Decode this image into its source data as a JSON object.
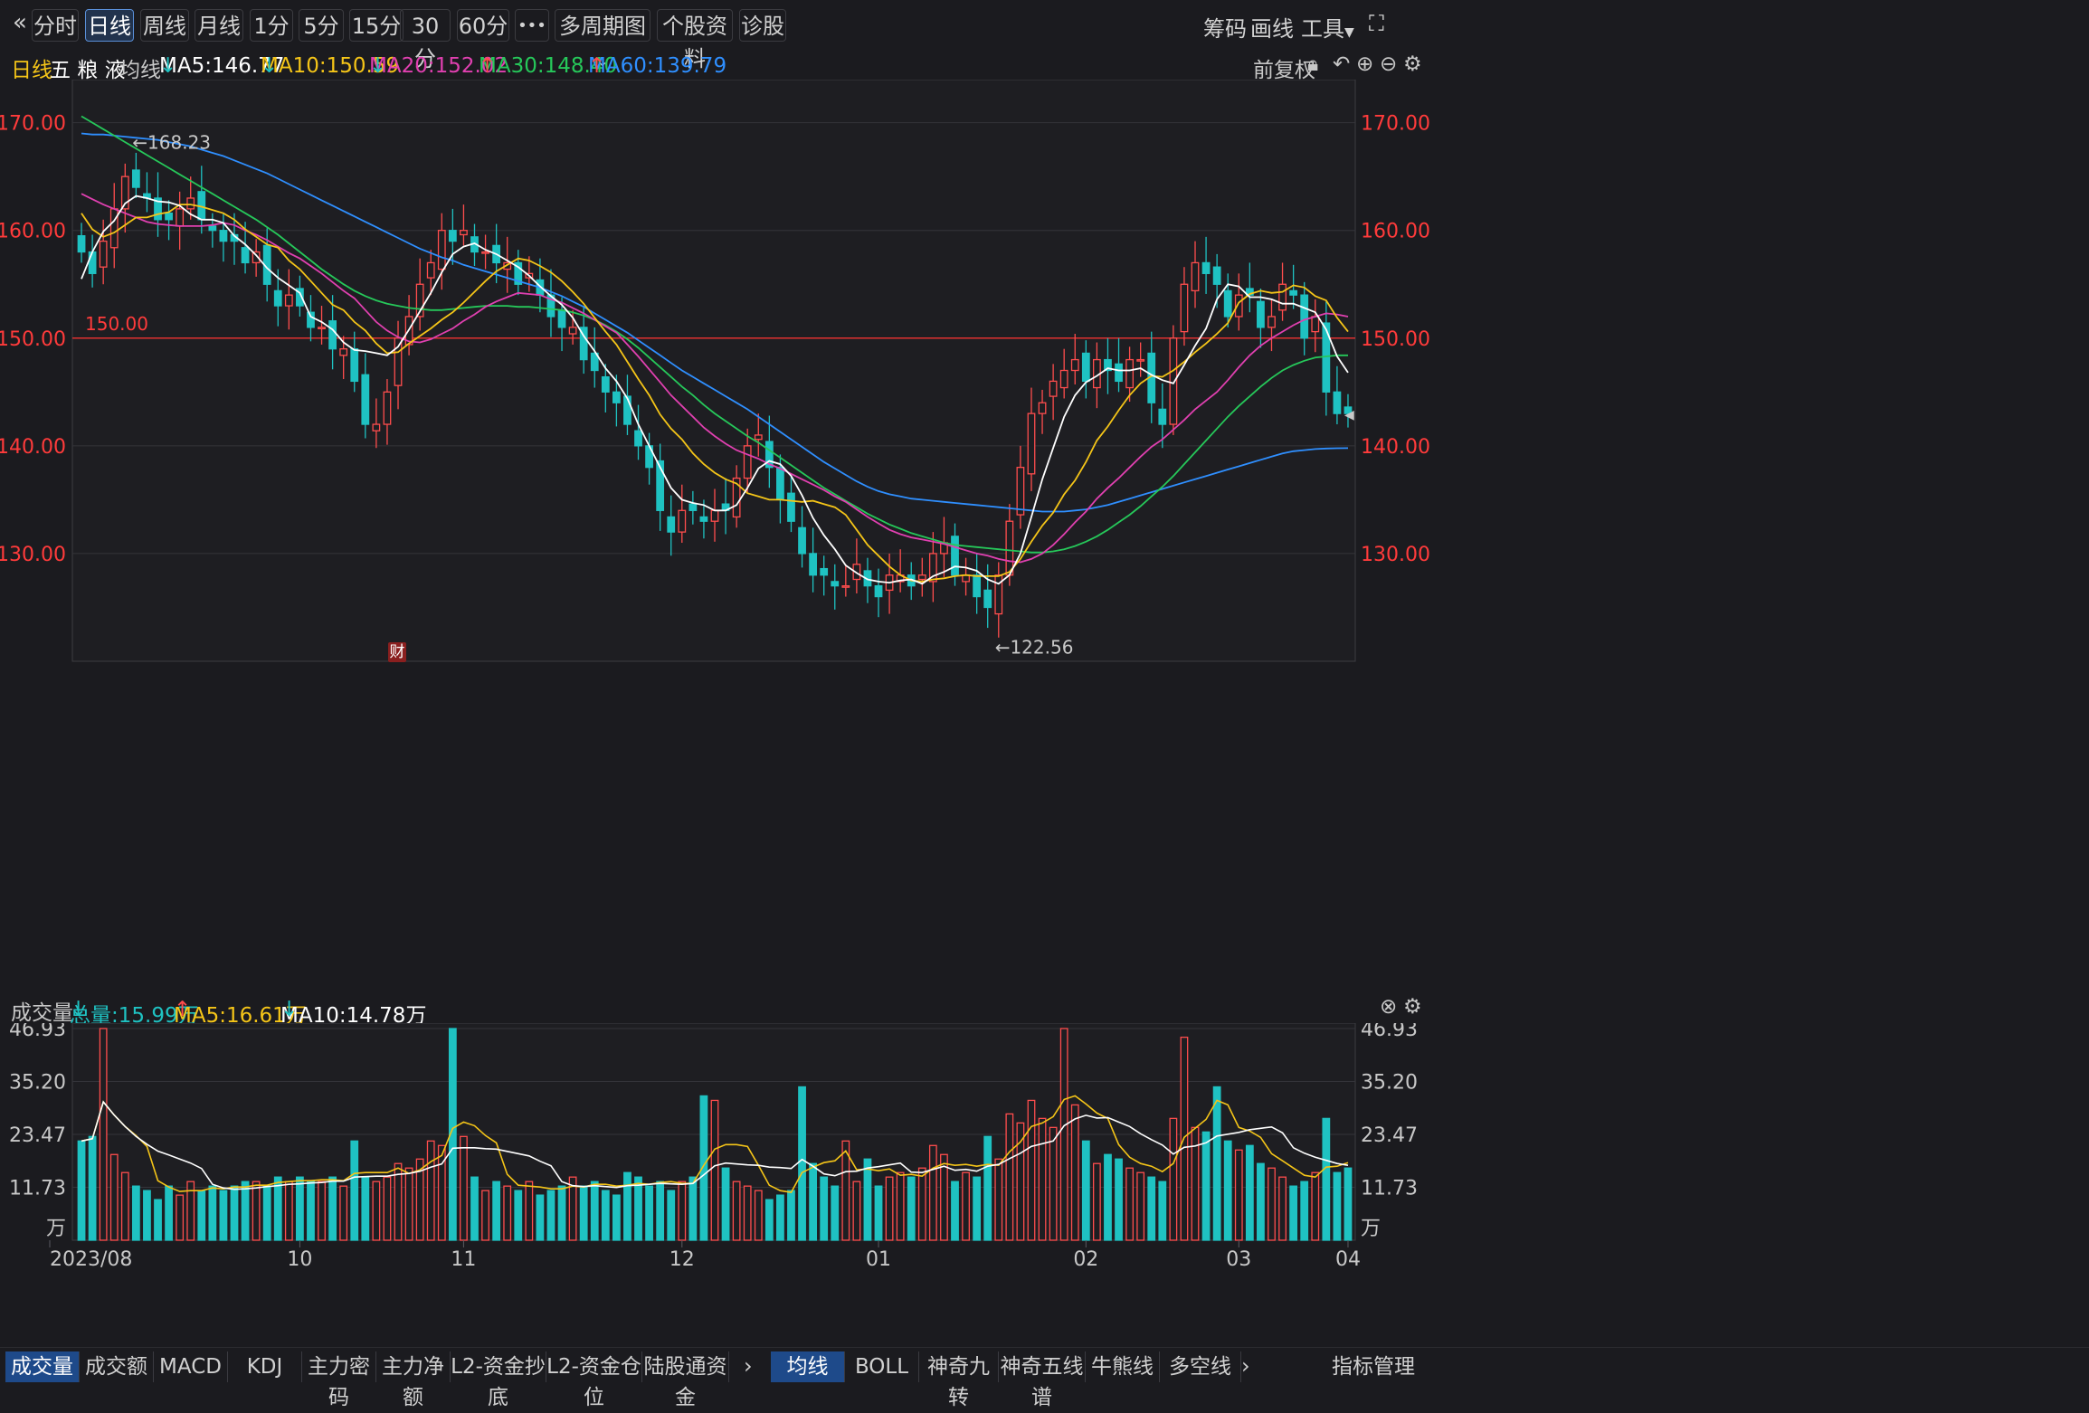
{
  "toolbar": {
    "back_glyph": "«",
    "tabs": [
      "分时",
      "日线",
      "周线",
      "月线",
      "1分",
      "5分",
      "15分",
      "30分",
      "60分"
    ],
    "active_tab": "日线",
    "more_glyph": "•••",
    "multi_period": "多周期图",
    "stock_info": "个股资料",
    "diagnose": "诊股",
    "right": [
      "筹码",
      "画线",
      "工具"
    ],
    "fullscreen_glyph": "⛶"
  },
  "info": {
    "period": "日线",
    "name": "五 粮 液",
    "ma_label": "均线",
    "ma5": "MA5:146.77",
    "ma10": "MA10:150.59",
    "ma20": "MA20:152.02",
    "ma30": "MA30:148.40",
    "ma60": "MA60:139.79",
    "adjust": "前复权"
  },
  "volume_info": {
    "title": "成交量",
    "total": "总量:15.99万",
    "ma5": "MA5:16.61万",
    "ma10": "MA10:14.78万"
  },
  "bottom_tabs_left": [
    "成交量",
    "成交额",
    "MACD",
    "KDJ",
    "主力密码",
    "主力净额",
    "L2-资金抄底",
    "L2-资金仓位",
    "陆股通资金"
  ],
  "bottom_tabs_right": [
    "均线",
    "BOLL",
    "神奇九转",
    "神奇五线谱",
    "牛熊线",
    "多空线"
  ],
  "bottom_active_left": "成交量",
  "bottom_active_right": "均线",
  "indicator_manage": "指标管理",
  "colors": {
    "up": "#ff4d4d",
    "down": "#1fc2c2",
    "ma5": "#ffffff",
    "ma10": "#f5c518",
    "ma20": "#e040b0",
    "ma30": "#26c85a",
    "ma60": "#2f8fff",
    "axis_text": "#ff3b3b"
  },
  "chart_data": {
    "type": "candlestick",
    "price_axis": {
      "ticks": [
        "170.00",
        "160.00",
        "150.00",
        "140.00",
        "130.00"
      ],
      "ylim": [
        120,
        174
      ]
    },
    "reference_line": {
      "value": 150.0,
      "label": "150.00"
    },
    "annotations": [
      {
        "text": "←168.23",
        "value": 168.23
      },
      {
        "text": "←122.56",
        "value": 122.56
      }
    ],
    "finance_marker": "财",
    "x_labels": [
      "2023/08",
      "10",
      "11",
      "12",
      "01",
      "02",
      "03",
      "04"
    ],
    "closes": [
      158,
      156,
      159,
      162,
      165,
      164,
      163,
      161,
      161,
      162,
      163,
      161,
      160,
      159,
      159,
      157,
      158,
      155,
      153,
      154,
      153,
      151,
      151,
      149,
      149,
      146,
      142,
      142,
      145,
      150,
      152,
      155,
      157,
      160,
      159,
      160,
      158,
      158,
      157,
      157,
      155,
      156,
      154,
      152,
      151,
      151,
      148,
      147,
      145,
      144,
      142,
      140,
      138,
      134,
      132,
      134,
      134,
      133,
      134,
      134,
      137,
      140,
      141,
      138,
      135,
      133,
      130,
      128,
      128,
      127,
      127,
      129,
      127,
      126,
      128,
      128,
      127,
      128,
      130,
      131,
      128,
      128,
      126,
      125,
      128,
      133,
      138,
      143,
      144,
      146,
      147,
      148,
      146,
      148,
      147,
      146,
      148,
      148,
      144,
      142,
      150,
      155,
      157,
      156,
      155,
      152,
      154,
      154,
      151,
      152,
      155,
      154,
      150,
      152,
      145,
      143,
      143
    ],
    "ma5": [
      155.5,
      158.0,
      159.9,
      160.9,
      162.5,
      163.2,
      163.0,
      162.7,
      162.6,
      162.3,
      161.5,
      161.0,
      161.0,
      160.7,
      159.5,
      158.7,
      157.7,
      156.5,
      155.6,
      154.9,
      154.2,
      152.0,
      151.5,
      150.8,
      149.6,
      148.9,
      148.8,
      148.6,
      148.4,
      149.2,
      150.8,
      152.5,
      154.2,
      156.1,
      157.8,
      158.5,
      158.8,
      158.2,
      157.8,
      157.2,
      156.6,
      155.8,
      154.8,
      153.9,
      153.1,
      151.9,
      150.2,
      148.8,
      147.2,
      146.0,
      144.4,
      142.0,
      140.0,
      138.0,
      136.1,
      135.0,
      134.7,
      134.5,
      134.0,
      134.0,
      134.5,
      136.1,
      137.9,
      138.6,
      138.3,
      137.2,
      135.4,
      133.3,
      131.7,
      130.4,
      128.9,
      128.2,
      127.6,
      127.4,
      127.3,
      127.5,
      127.6,
      127.2,
      127.9,
      128.3,
      128.8,
      128.7,
      128.4,
      127.6,
      127.2,
      128.0,
      130.0,
      133.4,
      136.9,
      139.8,
      142.7,
      144.7,
      145.9,
      146.5,
      147.2,
      147.0,
      147.0,
      147.2,
      146.6,
      146.1,
      145.8,
      147.5,
      149.3,
      150.9,
      153.6,
      155.0,
      154.8,
      153.8,
      153.8,
      153.6,
      153.2,
      153.2,
      152.8,
      152.4,
      150.8,
      148.3,
      146.8
    ],
    "ma10": [
      161.6,
      160.1,
      159.4,
      159.8,
      160.5,
      161.2,
      161.2,
      161.5,
      161.7,
      162.4,
      162.4,
      162.2,
      161.9,
      161.6,
      161.0,
      160.1,
      159.4,
      158.7,
      158.4,
      157.2,
      156.4,
      155.3,
      154.2,
      153.1,
      152.6,
      151.5,
      150.7,
      149.5,
      148.6,
      148.7,
      149.5,
      150.2,
      150.9,
      151.7,
      152.4,
      153.3,
      154.3,
      155.3,
      156.2,
      156.8,
      157.4,
      157.2,
      156.7,
      156.1,
      155.3,
      154.3,
      153.2,
      151.9,
      150.6,
      149.4,
      147.8,
      146.2,
      144.7,
      142.9,
      141.6,
      140.6,
      139.3,
      138.3,
      137.5,
      136.9,
      136.5,
      135.6,
      135.3,
      135.0,
      135.0,
      134.9,
      134.8,
      134.9,
      134.6,
      134.3,
      133.6,
      132.2,
      130.8,
      129.8,
      128.8,
      128.0,
      127.5,
      127.4,
      127.6,
      127.7,
      127.9,
      128.0,
      127.9,
      127.9,
      127.9,
      128.3,
      129.5,
      131.1,
      132.6,
      133.8,
      135.5,
      136.8,
      138.5,
      140.5,
      141.8,
      143.3,
      144.7,
      145.8,
      146.5,
      146.4,
      147.0,
      147.8,
      148.7,
      149.5,
      150.4,
      151.4,
      153.3,
      154.1,
      154.4,
      154.2,
      154.3,
      154.9,
      154.7,
      153.9,
      153.5,
      151.9,
      150.6
    ],
    "ma20": [
      163.4,
      162.9,
      162.4,
      162.0,
      161.6,
      161.2,
      160.8,
      160.6,
      160.5,
      160.4,
      160.4,
      160.4,
      160.5,
      160.7,
      160.5,
      160.0,
      159.6,
      159.1,
      158.5,
      157.9,
      157.4,
      156.7,
      156.0,
      155.2,
      154.4,
      153.7,
      152.6,
      151.5,
      150.7,
      150.1,
      149.7,
      149.6,
      149.9,
      150.4,
      150.9,
      151.6,
      152.2,
      152.9,
      153.4,
      153.8,
      154.2,
      154.1,
      154.0,
      153.6,
      153.3,
      152.8,
      152.3,
      151.7,
      151.1,
      150.5,
      149.4,
      148.3,
      147.1,
      145.9,
      144.7,
      143.7,
      142.7,
      141.7,
      140.9,
      140.2,
      139.6,
      139.2,
      138.8,
      138.3,
      137.9,
      137.4,
      136.9,
      136.4,
      135.9,
      135.3,
      134.8,
      134.1,
      133.4,
      132.8,
      132.2,
      131.8,
      131.5,
      131.3,
      131.1,
      130.9,
      130.6,
      130.3,
      130.0,
      129.8,
      129.5,
      129.3,
      129.2,
      129.5,
      130.0,
      130.8,
      131.8,
      132.9,
      133.9,
      135.1,
      136.1,
      137.0,
      138.0,
      139.0,
      139.9,
      140.6,
      141.5,
      142.4,
      143.4,
      144.2,
      145.0,
      146.1,
      147.3,
      148.4,
      149.3,
      150.0,
      150.6,
      151.2,
      151.7,
      152.0,
      152.3,
      152.2,
      152.0
    ],
    "ma30": [
      170.6,
      170.0,
      169.4,
      168.8,
      168.2,
      167.6,
      167.0,
      166.4,
      165.8,
      165.2,
      164.6,
      164.0,
      163.4,
      162.8,
      162.2,
      161.6,
      161.0,
      160.3,
      159.6,
      158.8,
      158.0,
      157.2,
      156.4,
      155.7,
      155.0,
      154.4,
      153.9,
      153.5,
      153.2,
      153.0,
      152.8,
      152.7,
      152.6,
      152.6,
      152.7,
      152.8,
      152.9,
      153.0,
      153.0,
      153.0,
      152.9,
      152.9,
      152.8,
      152.7,
      152.6,
      152.4,
      152.1,
      151.7,
      151.2,
      150.6,
      149.9,
      149.1,
      148.2,
      147.3,
      146.4,
      145.5,
      144.7,
      143.8,
      143.0,
      142.3,
      141.6,
      140.9,
      140.3,
      139.6,
      138.9,
      138.2,
      137.5,
      136.8,
      136.1,
      135.5,
      134.9,
      134.3,
      133.7,
      133.2,
      132.7,
      132.3,
      131.9,
      131.6,
      131.3,
      131.0,
      130.8,
      130.7,
      130.6,
      130.5,
      130.4,
      130.3,
      130.2,
      130.1,
      130.1,
      130.2,
      130.4,
      130.7,
      131.1,
      131.6,
      132.2,
      132.9,
      133.6,
      134.4,
      135.3,
      136.2,
      137.2,
      138.3,
      139.4,
      140.5,
      141.6,
      142.7,
      143.7,
      144.6,
      145.5,
      146.3,
      147.0,
      147.5,
      147.9,
      148.2,
      148.3,
      148.4,
      148.4
    ],
    "ma60": [
      169.0,
      168.9,
      168.9,
      168.8,
      168.7,
      168.6,
      168.5,
      168.4,
      168.2,
      168.0,
      167.8,
      167.5,
      167.2,
      166.9,
      166.5,
      166.1,
      165.7,
      165.3,
      164.8,
      164.3,
      163.8,
      163.3,
      162.8,
      162.3,
      161.8,
      161.3,
      160.8,
      160.3,
      159.8,
      159.3,
      158.8,
      158.3,
      157.9,
      157.5,
      157.2,
      156.8,
      156.5,
      156.2,
      155.9,
      155.6,
      155.3,
      155.0,
      154.7,
      154.3,
      153.9,
      153.4,
      152.9,
      152.3,
      151.7,
      151.1,
      150.5,
      149.8,
      149.1,
      148.4,
      147.7,
      147.0,
      146.4,
      145.8,
      145.2,
      144.6,
      144.0,
      143.4,
      142.7,
      142.0,
      141.3,
      140.6,
      139.9,
      139.2,
      138.5,
      137.9,
      137.3,
      136.7,
      136.2,
      135.8,
      135.5,
      135.3,
      135.1,
      135.0,
      134.9,
      134.8,
      134.7,
      134.6,
      134.5,
      134.4,
      134.3,
      134.2,
      134.1,
      134.0,
      133.9,
      133.9,
      133.9,
      134.0,
      134.1,
      134.3,
      134.5,
      134.8,
      135.1,
      135.4,
      135.7,
      136.0,
      136.3,
      136.6,
      136.9,
      137.2,
      137.5,
      137.8,
      138.1,
      138.4,
      138.7,
      139.0,
      139.3,
      139.5,
      139.6,
      139.7,
      139.75,
      139.78,
      139.79
    ]
  },
  "volume_chart": {
    "unit": "万",
    "ticks": [
      "46.93",
      "35.20",
      "23.47",
      "11.73"
    ],
    "ylim": [
      0,
      46.93
    ],
    "volumes": [
      22,
      23,
      47,
      19,
      15,
      12,
      11,
      9,
      12,
      10,
      13,
      11,
      12,
      11,
      12,
      13,
      13,
      12,
      14,
      13,
      14,
      13,
      13,
      14,
      12,
      22,
      14,
      13,
      14,
      17,
      16,
      18,
      22,
      21,
      47,
      23,
      14,
      11,
      13,
      12,
      11,
      13,
      10,
      11,
      12,
      14,
      12,
      13,
      11,
      10,
      15,
      14,
      12,
      13,
      11,
      13,
      14,
      32,
      31,
      16,
      13,
      12,
      11,
      9,
      10,
      11,
      34,
      17,
      14,
      12,
      22,
      13,
      18,
      12,
      14,
      15,
      14,
      16,
      21,
      19,
      13,
      15,
      14,
      23,
      18,
      28,
      26,
      31,
      27,
      25,
      47,
      30,
      22,
      17,
      19,
      18,
      16,
      15,
      14,
      13,
      27,
      45,
      25,
      24,
      34,
      22,
      20,
      21,
      17,
      16,
      14,
      12,
      13,
      15,
      27,
      15,
      16
    ]
  }
}
